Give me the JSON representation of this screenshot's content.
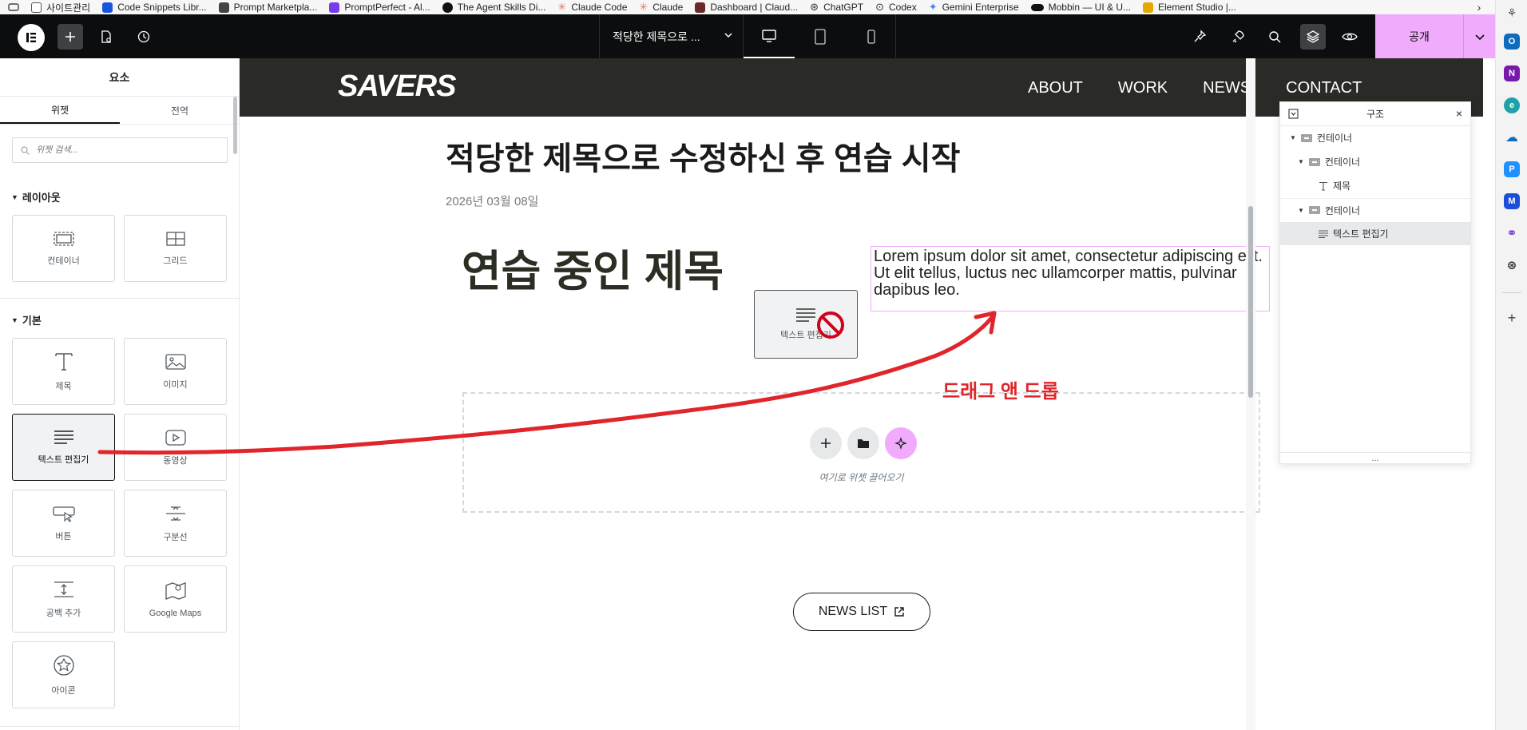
{
  "bookmarks": {
    "items": [
      {
        "label": "사이트관리",
        "color": "#777777"
      },
      {
        "label": "Code Snippets Libr...",
        "color": "#1a56db"
      },
      {
        "label": "Prompt Marketpla...",
        "color": "#444444"
      },
      {
        "label": "PromptPerfect - Al...",
        "color": "#7c3aed"
      },
      {
        "label": "The Agent Skills Di...",
        "color": "#111111"
      },
      {
        "label": "Claude Code",
        "color": "#d97757"
      },
      {
        "label": "Claude",
        "color": "#d97757"
      },
      {
        "label": "Dashboard | Claud...",
        "color": "#6b2a2a"
      },
      {
        "label": "ChatGPT",
        "color": "#333333"
      },
      {
        "label": "Codex",
        "color": "#333333"
      },
      {
        "label": "Gemini Enterprise",
        "color": "#4285f4"
      },
      {
        "label": "Mobbin — UI & U...",
        "color": "#111111"
      },
      {
        "label": "Element Studio |...",
        "color": "#e6a800"
      }
    ]
  },
  "topbar": {
    "doc_title": "적당한 제목으로 ...",
    "publish_label": "공개"
  },
  "panel": {
    "title": "요소",
    "tabs": [
      {
        "label": "위젯"
      },
      {
        "label": "전역"
      }
    ],
    "search_placeholder": "위젯 검색...",
    "sections": {
      "layout": "레이아웃",
      "basic": "기본"
    },
    "layout_widgets": [
      {
        "label": "컨테이너",
        "icon": "container-icon"
      },
      {
        "label": "그리드",
        "icon": "grid-icon"
      }
    ],
    "basic_widgets": [
      {
        "label": "제목",
        "icon": "heading-icon"
      },
      {
        "label": "이미지",
        "icon": "image-icon"
      },
      {
        "label": "텍스트 편집기",
        "icon": "text-editor-icon"
      },
      {
        "label": "동영상",
        "icon": "video-icon"
      },
      {
        "label": "버튼",
        "icon": "button-icon"
      },
      {
        "label": "구분선",
        "icon": "divider-icon"
      },
      {
        "label": "공백 추가",
        "icon": "spacer-icon"
      },
      {
        "label": "Google Maps",
        "icon": "map-icon"
      },
      {
        "label": "아이콘",
        "icon": "star-icon"
      }
    ]
  },
  "canvas": {
    "site_logo": "SAVERS",
    "nav": [
      "ABOUT",
      "WORK",
      "NEWS",
      "CONTACT"
    ],
    "post_title": "적당한 제목으로 수정하신 후 연습 시작",
    "post_date": "2026년 03월 08일",
    "practice_title": "연습 중인 제목",
    "lorem": "Lorem ipsum dolor sit amet, consectetur adipiscing elit. Ut elit tellus, luctus nec ullamcorper mattis, pulvinar dapibus leo.",
    "drag_ghost_label": "텍스트 편집기",
    "drop_hint": "여기로 위젯 끌어오기",
    "annotation": "드래그 앤 드롭",
    "news_button": "NEWS LIST",
    "accent_color": "#f0abfc",
    "annotation_color": "#e0252b"
  },
  "structure": {
    "title": "구조",
    "items": [
      {
        "label": "컨테이너",
        "icon": "container-icon",
        "depth": 0,
        "expanded": true
      },
      {
        "label": "컨테이너",
        "icon": "container-icon",
        "depth": 1,
        "expanded": true
      },
      {
        "label": "제목",
        "icon": "heading-icon",
        "depth": 2
      },
      {
        "label": "컨테이너",
        "icon": "container-icon",
        "depth": 1,
        "expanded": true
      },
      {
        "label": "텍스트 편집기",
        "icon": "text-editor-icon",
        "depth": 2,
        "selected": true
      }
    ],
    "footer": "..."
  }
}
